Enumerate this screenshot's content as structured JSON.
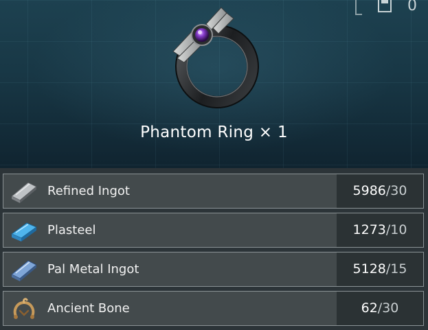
{
  "item": {
    "name": "Phantom Ring",
    "quantity_label": "× 1"
  },
  "corner": {
    "value": "0"
  },
  "materials": [
    {
      "name": "Refined Ingot",
      "have": "5986",
      "need": "30",
      "icon": "refined-ingot-icon"
    },
    {
      "name": "Plasteel",
      "have": "1273",
      "need": "10",
      "icon": "plasteel-icon"
    },
    {
      "name": "Pal Metal Ingot",
      "have": "5128",
      "need": "15",
      "icon": "pal-metal-ingot-icon"
    },
    {
      "name": "Ancient Bone",
      "have": "62",
      "need": "30",
      "icon": "ancient-bone-icon"
    }
  ],
  "colors": {
    "panel_bg": "#1b3a47",
    "row_bg": "#434a4c",
    "qty_bg": "#2b3234",
    "gem": "#7a3cc4"
  }
}
